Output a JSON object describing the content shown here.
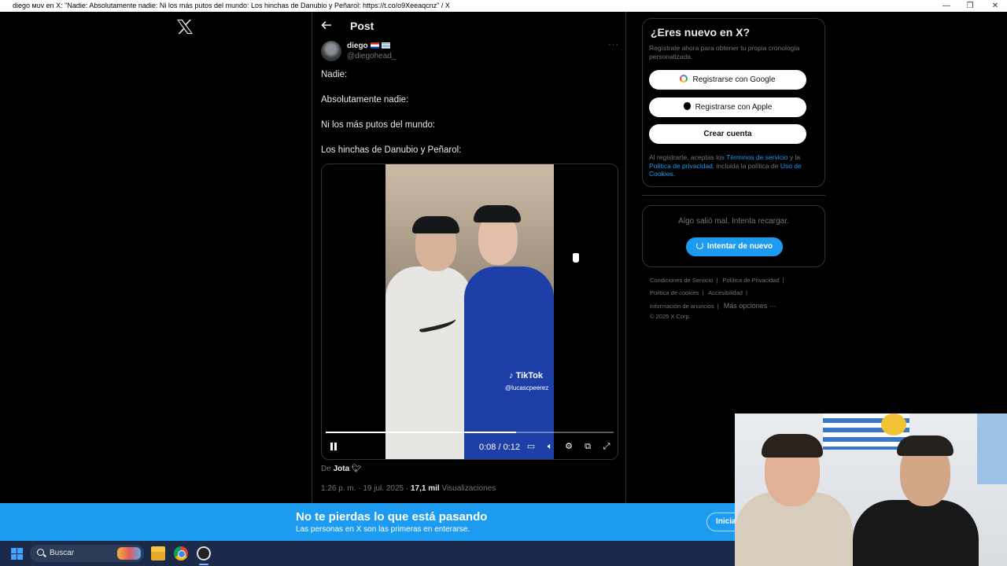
{
  "window": {
    "title": "diego ᴍᴜᴠ en X: \"Nadie: Absolutamente nadie: Ni los más putos del mundo: Los hinchas de Danubio y Peñarol: https://t.co/o9Xeeaqcnz\" / X",
    "minimize": "—",
    "maximize": "❐",
    "close": "✕"
  },
  "nav": {
    "logo": "x-logo"
  },
  "post": {
    "header_title": "Post",
    "author": {
      "name": "diego",
      "handle": "@diegohead_"
    },
    "more": "···",
    "lines": [
      "Nadie:",
      "Absolutamente nadie:",
      "Ni los más putos del mundo:",
      "Los hinchas de Danubio y Peñarol:"
    ],
    "video": {
      "watermark": "TikTok",
      "watermark_handle": "@lucascpeerez",
      "current_time": "0:08",
      "duration": "0:12",
      "progress": 0.66
    },
    "via_prefix": "De",
    "via_name": "Jota",
    "time": "1:26 p. m.",
    "date": "19 jul. 2025",
    "views_count": "17,1 mil",
    "views_label": "Visualizaciones"
  },
  "signup": {
    "title": "¿Eres nuevo en X?",
    "subtitle": "Regístrate ahora para obtener tu propia cronología personalizada.",
    "google_button": "Registrarse con Google",
    "apple_button": "Registrarse con Apple",
    "create_button": "Crear cuenta",
    "legal_prefix": "Al registrarte, aceptas los",
    "terms_link": "Términos de servicio",
    "legal_and": "y la",
    "privacy_link": "Política de privacidad",
    "legal_including": ", incluida la política de",
    "cookies_link": "Uso de Cookies",
    "legal_end": "."
  },
  "error_card": {
    "message": "Algo salió mal. Intenta recargar.",
    "retry_button": "Intentar de nuevo"
  },
  "footer": {
    "links": [
      "Condiciones de Servicio",
      "Política de Privacidad",
      "Política de cookies",
      "Accesibilidad",
      "Información de anuncios",
      "Más opciones ···"
    ],
    "copyright": "© 2025 X Corp."
  },
  "banner": {
    "title": "No te pierdas lo que está pasando",
    "subtitle": "Las personas en X son las primeras en enterarse.",
    "login_button": "Iniciar sesión"
  },
  "taskbar": {
    "search_label": "Buscar"
  }
}
